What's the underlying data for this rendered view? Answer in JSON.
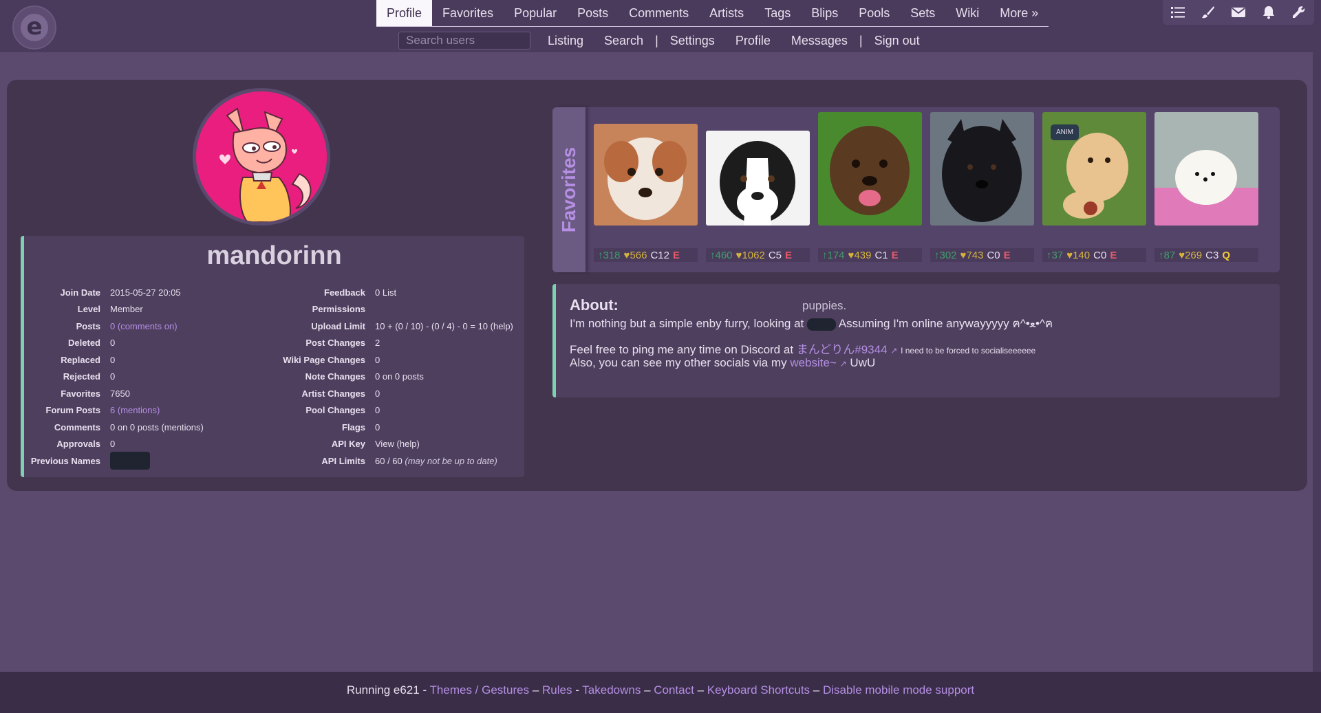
{
  "header": {
    "logo_letter": "e",
    "nav": [
      {
        "label": "Profile",
        "active": true
      },
      {
        "label": "Favorites"
      },
      {
        "label": "Popular"
      },
      {
        "label": "Posts"
      },
      {
        "label": "Comments"
      },
      {
        "label": "Artists"
      },
      {
        "label": "Tags"
      },
      {
        "label": "Blips"
      },
      {
        "label": "Pools"
      },
      {
        "label": "Sets"
      },
      {
        "label": "Wiki"
      },
      {
        "label": "More »"
      }
    ],
    "search_placeholder": "Search users",
    "subnav": [
      "Listing",
      "Search",
      "|",
      "Settings",
      "Profile",
      "Messages",
      "|",
      "Sign out"
    ],
    "tools": [
      "list-icon",
      "brush-icon",
      "mail-icon",
      "bell-icon",
      "wrench-icon"
    ]
  },
  "profile": {
    "username": "mandorinn",
    "left": [
      {
        "label": "Join Date",
        "value": "2015-05-27 20:05"
      },
      {
        "label": "Level",
        "value": "Member"
      },
      {
        "label": "Posts",
        "value": "0",
        "extra": "(comments on)"
      },
      {
        "label": "Deleted",
        "value": "0"
      },
      {
        "label": "Replaced",
        "value": "0"
      },
      {
        "label": "Rejected",
        "value": "0"
      },
      {
        "label": "Favorites",
        "value": "7650"
      },
      {
        "label": "Forum Posts",
        "value": "6",
        "extra": "(mentions)"
      },
      {
        "label": "Comments",
        "value": "0 on 0 posts (mentions)"
      },
      {
        "label": "Approvals",
        "value": "0"
      },
      {
        "label": "Previous Names",
        "value": ""
      }
    ],
    "right": [
      {
        "label": "Feedback",
        "value": "0 List"
      },
      {
        "label": "Permissions",
        "value": ""
      },
      {
        "label": "Upload Limit",
        "value": "10 + (0 / 10) - (0 / 4) - 0 = 10 (help)"
      },
      {
        "label": "Post Changes",
        "value": "2"
      },
      {
        "label": "Wiki Page Changes",
        "value": "0"
      },
      {
        "label": "Note Changes",
        "value": "0 on 0 posts"
      },
      {
        "label": "Artist Changes",
        "value": "0"
      },
      {
        "label": "Pool Changes",
        "value": "0"
      },
      {
        "label": "Flags",
        "value": "0"
      },
      {
        "label": "API Key",
        "value": "View (help)"
      },
      {
        "label": "API Limits",
        "value": "60 / 60",
        "note": "(may not be up to date)"
      }
    ]
  },
  "favorites": {
    "title": "Favorites",
    "items": [
      {
        "score": "318",
        "favs": "566",
        "comments": "C12",
        "rating": "E"
      },
      {
        "score": "460",
        "favs": "1062",
        "comments": "C5",
        "rating": "E"
      },
      {
        "score": "174",
        "favs": "439",
        "comments": "C1",
        "rating": "E"
      },
      {
        "score": "302",
        "favs": "743",
        "comments": "C0",
        "rating": "E"
      },
      {
        "score": "37",
        "favs": "140",
        "comments": "C0",
        "rating": "E",
        "badge": "ANIM"
      },
      {
        "score": "87",
        "favs": "269",
        "comments": "C3",
        "rating": "Q"
      }
    ]
  },
  "about": {
    "title": "About:",
    "floating_text": "puppies.",
    "line1_pre": "I'm nothing but a simple enby furry, looking at",
    "line1_post": "Assuming I'm online anywayyyyy ฅ^•ﻌ•^ฅ",
    "line2_pre": "Feel free to ping me any time on Discord at",
    "discord_link": "まんどりん#9344",
    "line2_small": "I need to be forced to socialiseeeeee",
    "line3_pre": "Also, you can see my other socials via my",
    "website_link": "website~",
    "line3_post": "UwU"
  },
  "footer": {
    "running": "Running e621",
    "links": [
      "Themes / Gestures",
      "Rules",
      "Takedowns",
      "Contact",
      "Keyboard Shortcuts",
      "Disable mobile mode support"
    ]
  }
}
